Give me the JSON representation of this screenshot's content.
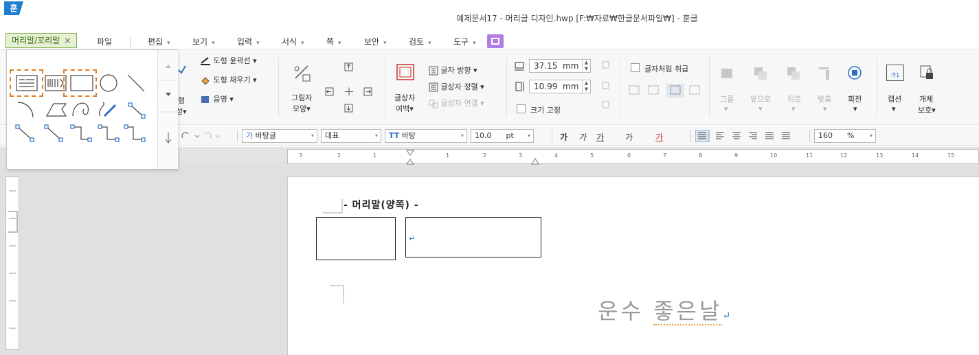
{
  "window": {
    "app_logo": "훈",
    "title": "예제문서17 - 머리글 디자인.hwp [F:₩자료₩한글문서파일₩] - 훈글"
  },
  "menubar": {
    "context_tab": {
      "label": "머리말/꼬리말",
      "close": "×"
    },
    "items": [
      {
        "label": "파일",
        "arrow": ""
      },
      {
        "label": "편집",
        "arrow": "▾"
      },
      {
        "label": "보기",
        "arrow": "▾"
      },
      {
        "label": "입력",
        "arrow": "▾"
      },
      {
        "label": "서식",
        "arrow": "▾"
      },
      {
        "label": "쪽",
        "arrow": "▾"
      },
      {
        "label": "보안",
        "arrow": "▾"
      },
      {
        "label": "검토",
        "arrow": "▾"
      },
      {
        "label": "도구",
        "arrow": "▾"
      }
    ]
  },
  "ribbon": {
    "shape_outline": "도형 윤곽선",
    "shape_fill": "도형 채우기",
    "shade": "음영",
    "partial_a": "형",
    "partial_b": "성▾",
    "shadow_shape_1": "그림자",
    "shadow_shape_2": "모양▾",
    "textbox_margin_1": "글상자",
    "textbox_margin_2": "여백▾",
    "text_direction": "글자 방향",
    "text_align": "글상자 정렬",
    "text_link": "글상자 연결",
    "width_value": "37.15",
    "width_unit": "mm",
    "height_value": "10.99",
    "height_unit": "mm",
    "fix_size": "크기 고정",
    "treat_as_char": "글자처럼 취급",
    "group": "그룹",
    "bring_front": "앞으로",
    "send_back": "뒤로",
    "align": "맞춤",
    "rotate": "회전",
    "caption": "캡션",
    "caption_icon": "가1",
    "protect_1": "개체",
    "protect_2": "보호▾",
    "dropdown_arrow": "▾",
    "spin_up": "▲",
    "spin_down": "▼"
  },
  "format_bar": {
    "style": "바탕글",
    "style_icon": "가",
    "language": "대표",
    "font": "바탕",
    "font_icon": "TT",
    "size": "10.0",
    "size_unit": "pt",
    "bold": "가",
    "italic": "가",
    "underline": "가",
    "strike": "가",
    "color": "가",
    "zoom": "160",
    "zoom_unit": "%"
  },
  "ruler": {
    "numbers": [
      "3",
      "2",
      "1",
      "1",
      "2",
      "3",
      "4",
      "5",
      "6",
      "7",
      "8",
      "9",
      "10",
      "11",
      "12",
      "13",
      "14",
      "15"
    ]
  },
  "document": {
    "header_label": "- 머리말(양쪽) -",
    "big_text_1": "운수",
    "big_text_2": "좋은날",
    "para_mark": "↵"
  },
  "colors": {
    "accent_blue": "#1e7fd0",
    "context_tab_green": "#7fb24a",
    "share_purple": "#b07ee3",
    "selection_orange": "#e17b22",
    "shape_blue": "#2b6cc4"
  }
}
